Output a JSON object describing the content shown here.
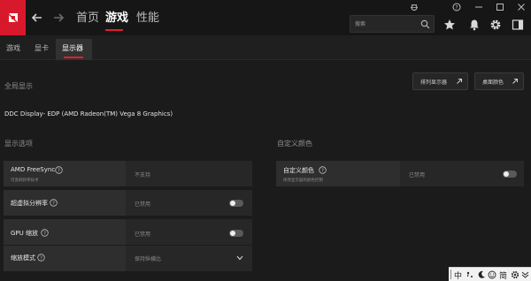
{
  "topbar": {
    "tabs": [
      "首页",
      "游戏",
      "性能"
    ],
    "active_tab": "游戏",
    "search_placeholder": "搜索"
  },
  "subtabs": {
    "items": [
      "游戏",
      "显卡",
      "显示器"
    ],
    "active": "显示器"
  },
  "main": {
    "global_display_title": "全局显示",
    "display_name": "DDC Display- EDP (AMD Radeon(TM) Vega 8 Graphics)",
    "rearrange_button": "排列显示器",
    "desktop_color_button": "桌面颜色",
    "display_options_title": "显示选项",
    "custom_color_title": "自定义颜色"
  },
  "options": [
    {
      "label": "AMD FreeSync",
      "sub": "可变刷新率技术",
      "value": "不支持"
    },
    {
      "label": "超虚拟分辨率",
      "value": "已禁用",
      "toggle": false
    },
    {
      "label": "GPU 缩放",
      "value": "已禁用",
      "toggle": false
    },
    {
      "label": "缩放模式",
      "value": "保持纵横比"
    }
  ],
  "custom_color": {
    "label": "自定义颜色",
    "sub": "修改显示器的颜色控制",
    "value": "已禁用",
    "toggle": false
  },
  "ime": {
    "items": [
      "中",
      "简"
    ]
  },
  "colors": {
    "accent": "#e0202f",
    "logo": "#d8192c",
    "background": "#1b1b1b",
    "card": "#272727"
  }
}
